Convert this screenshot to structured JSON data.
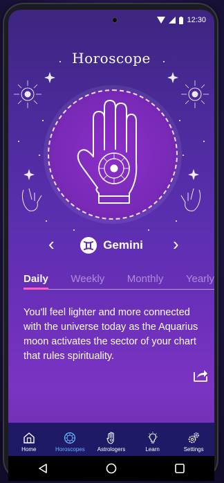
{
  "status": {
    "time": "12:30",
    "icons": [
      "signal-icon",
      "wifi-icon",
      "battery-icon"
    ]
  },
  "page": {
    "title": "Horoscope"
  },
  "sign": {
    "name": "Gemini",
    "icon": "gemini-icon"
  },
  "tabs": [
    {
      "label": "Daily",
      "active": true
    },
    {
      "label": "Weekly",
      "active": false
    },
    {
      "label": "Monthly",
      "active": false
    },
    {
      "label": "Yearly",
      "active": false
    }
  ],
  "reading": {
    "text": "You'll feel lighter and more connected with the universe today as the Aquarius moon activates the sector of your chart that rules spirituality."
  },
  "bottom_nav": [
    {
      "label": "Home",
      "icon": "home-icon",
      "active": false
    },
    {
      "label": "Horoscopes",
      "icon": "zodiac-wheel-icon",
      "active": true
    },
    {
      "label": "Astrologers",
      "icon": "hand-icon",
      "active": false
    },
    {
      "label": "Learn",
      "icon": "lightbulb-icon",
      "active": false
    },
    {
      "label": "Settings",
      "icon": "gears-icon",
      "active": false
    }
  ],
  "colors": {
    "accent": "#ff5fc0",
    "nav_active": "#6ab8ff",
    "nav_bg": "#1e1a66"
  }
}
